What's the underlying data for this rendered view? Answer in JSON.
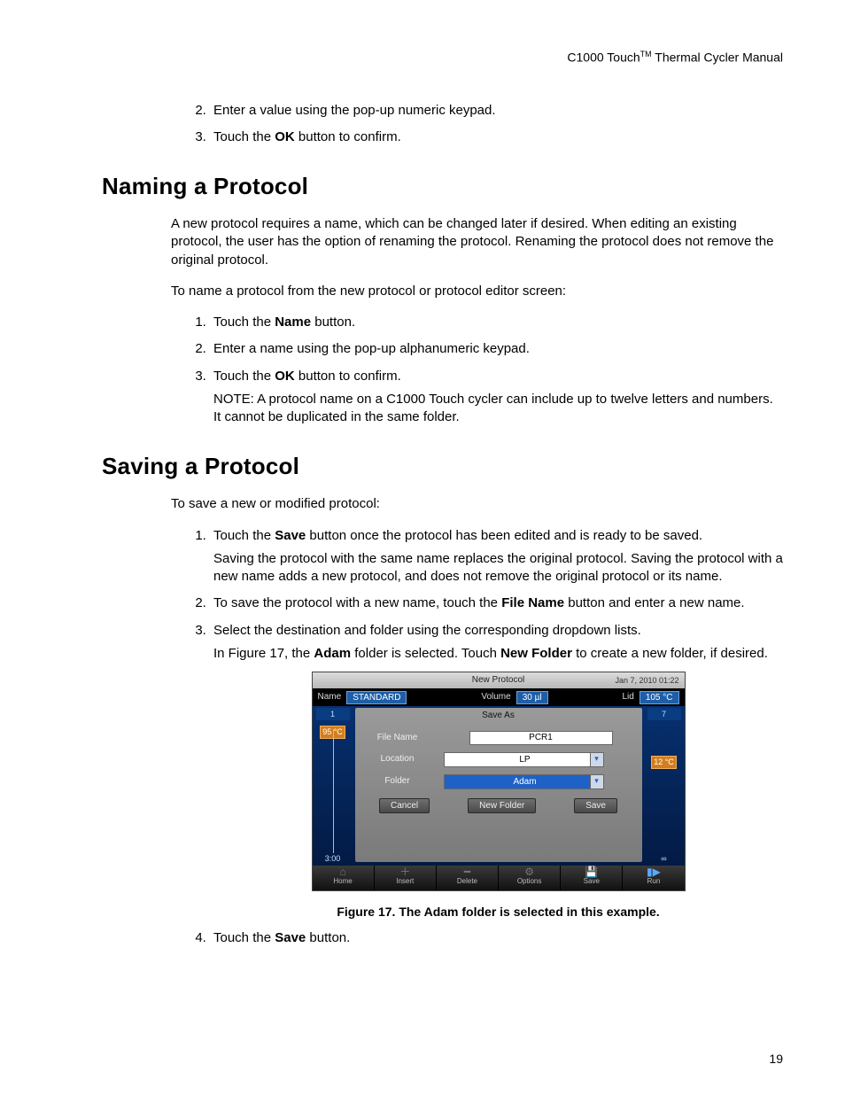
{
  "running_head": {
    "prefix": "C1000 Touch",
    "tm": "TM",
    "suffix": " Thermal Cycler Manual"
  },
  "top_list": {
    "start": 2,
    "items": [
      {
        "text": "Enter a value using the pop-up numeric keypad."
      },
      {
        "prefix": "Touch the ",
        "bold": "OK",
        "suffix": " button to confirm."
      }
    ]
  },
  "section_naming": {
    "title": "Naming a Protocol",
    "para1": "A new protocol requires a name, which can be changed later if desired. When editing an existing protocol, the user has the option of renaming the protocol. Renaming the protocol does not remove the original protocol.",
    "para2": "To name a protocol from the new protocol or protocol editor screen:",
    "list": [
      {
        "prefix": "Touch the ",
        "bold": "Name",
        "suffix": " button."
      },
      {
        "text": "Enter a name using the pop-up alphanumeric keypad."
      },
      {
        "prefix": "Touch the ",
        "bold": "OK",
        "suffix": " button to confirm.",
        "note": "NOTE: A protocol name on a C1000 Touch cycler can include up to twelve letters and numbers. It cannot be duplicated in the same folder."
      }
    ]
  },
  "section_saving": {
    "title": "Saving a Protocol",
    "para1": "To save a new or modified protocol:",
    "list": [
      {
        "prefix": "Touch the ",
        "bold": "Save",
        "suffix": " button once the protocol has been edited and is ready to be saved.",
        "sub": "Saving the protocol with the same name replaces the original protocol. Saving the protocol with a new name adds a new protocol, and does not remove the original protocol or its name."
      },
      {
        "prefix": "To save the protocol with a new name, touch the ",
        "bold": "File Name",
        "suffix": " button and enter a new name."
      },
      {
        "text": "Select the destination and folder using the corresponding dropdown lists.",
        "sub_rich": {
          "p": "In Figure 17, the ",
          "b1": "Adam",
          "m": " folder is selected. Touch ",
          "b2": "New Folder",
          "s": " to create a new folder, if desired."
        }
      },
      {
        "prefix": "Touch the ",
        "bold": "Save",
        "suffix": " button."
      }
    ]
  },
  "figure": {
    "caption": "Figure 17. The Adam folder is selected in this example.",
    "screen": {
      "title": "New Protocol",
      "timestamp": "Jan 7, 2010 01:22",
      "name_label": "Name",
      "name_value": "STANDARD",
      "volume_label": "Volume",
      "volume_value": "30 µl",
      "lid_label": "Lid",
      "lid_value": "105 °C",
      "left_col": {
        "step": "1",
        "temp": "95 °C",
        "time": "3:00"
      },
      "right_col": {
        "step": "7",
        "temp": "12 °C",
        "inf": "∞"
      },
      "saveas": {
        "title": "Save As",
        "file_label": "File Name",
        "file_value": "PCR1",
        "loc_label": "Location",
        "loc_value": "LP",
        "folder_label": "Folder",
        "folder_value": "Adam",
        "btn_cancel": "Cancel",
        "btn_newfolder": "New Folder",
        "btn_save": "Save"
      },
      "bbar": {
        "home": "Home",
        "insert": "Insert",
        "delete": "Delete",
        "options": "Options",
        "save": "Save",
        "run": "Run"
      }
    }
  },
  "page_number": "19"
}
